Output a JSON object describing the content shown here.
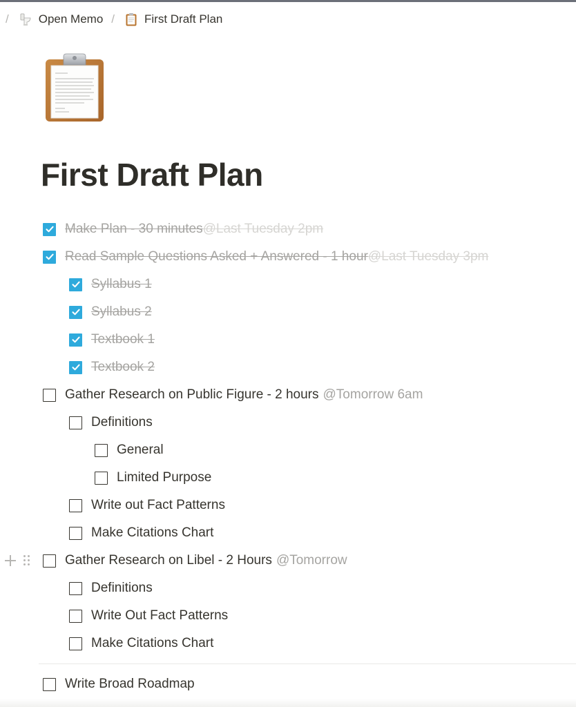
{
  "breadcrumb": {
    "items": [
      {
        "label": "Open Memo",
        "icon": "toilet-icon"
      },
      {
        "label": "First Draft Plan",
        "icon": "clipboard-icon"
      }
    ]
  },
  "page": {
    "icon": "clipboard-icon",
    "title": "First Draft Plan"
  },
  "colors": {
    "checkbox_checked": "#2eaadc",
    "text": "#37352f",
    "muted": "#a5a4a1"
  },
  "todos": [
    {
      "text": "Make Plan - 30 minutes ",
      "mention": "@Last Tuesday 2pm",
      "checked": true,
      "indent": 0
    },
    {
      "text": "Read Sample Questions Asked + Answered - 1 hour ",
      "mention": "@Last Tuesday 3pm",
      "checked": true,
      "indent": 0
    },
    {
      "text": "Syllabus 1",
      "mention": "",
      "checked": true,
      "indent": 1
    },
    {
      "text": "Syllabus 2",
      "mention": "",
      "checked": true,
      "indent": 1
    },
    {
      "text": "Textbook 1",
      "mention": "",
      "checked": true,
      "indent": 1
    },
    {
      "text": "Textbook 2",
      "mention": "",
      "checked": true,
      "indent": 1
    },
    {
      "text": "Gather Research on Public Figure - 2 hours",
      "mention": "@Tomorrow 6am",
      "checked": false,
      "indent": 0
    },
    {
      "text": "Definitions",
      "mention": "",
      "checked": false,
      "indent": 1
    },
    {
      "text": "General",
      "mention": "",
      "checked": false,
      "indent": 2
    },
    {
      "text": "Limited Purpose",
      "mention": "",
      "checked": false,
      "indent": 2
    },
    {
      "text": "Write out Fact Patterns",
      "mention": "",
      "checked": false,
      "indent": 1
    },
    {
      "text": "Make Citations Chart",
      "mention": "",
      "checked": false,
      "indent": 1
    },
    {
      "text": "Gather Research on Libel - 2 Hours",
      "mention": "@Tomorrow",
      "checked": false,
      "indent": 0
    },
    {
      "text": "Definitions",
      "mention": "",
      "checked": false,
      "indent": 1
    },
    {
      "text": "Write Out Fact Patterns",
      "mention": "",
      "checked": false,
      "indent": 1
    },
    {
      "text": "Make Citations Chart",
      "mention": "",
      "checked": false,
      "indent": 1
    },
    {
      "text": "Write Broad Roadmap",
      "mention": "",
      "checked": false,
      "indent": 0
    }
  ]
}
